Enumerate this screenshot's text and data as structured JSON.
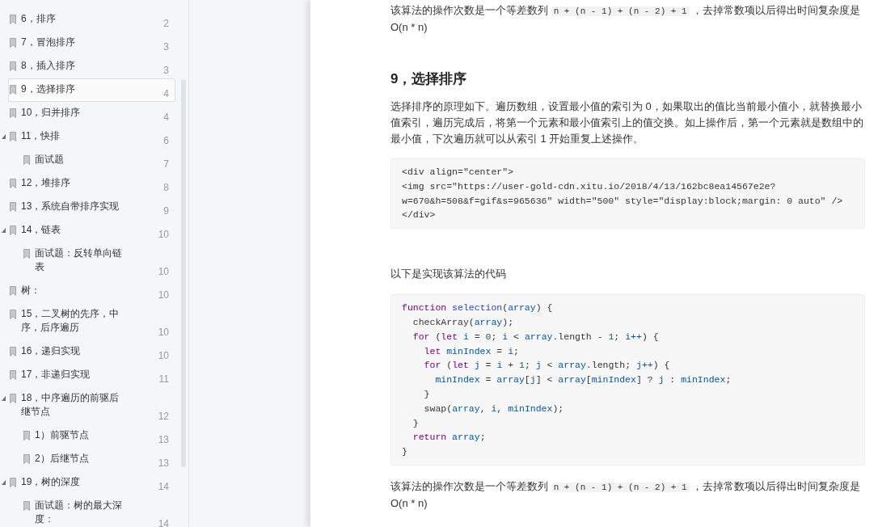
{
  "outline": {
    "items": [
      {
        "title": "6，排序",
        "page": "2",
        "selected": false
      },
      {
        "title": "7，冒泡排序",
        "page": "3",
        "selected": false
      },
      {
        "title": "8，插入排序",
        "page": "3",
        "selected": false
      },
      {
        "title": "9，选择排序",
        "page": "4",
        "selected": true
      },
      {
        "title": "10，归并排序",
        "page": "4",
        "selected": false
      },
      {
        "title": "11，快排",
        "page": "6",
        "selected": false,
        "expanded": true,
        "children": [
          {
            "title": "面试题",
            "page": "7",
            "selected": false
          }
        ]
      },
      {
        "title": "12，堆排序",
        "page": "8",
        "selected": false
      },
      {
        "title": "13，系统自带排序实现",
        "page": "9",
        "selected": false
      },
      {
        "title": "14，链表",
        "page": "10",
        "selected": false,
        "expanded": true,
        "children": [
          {
            "title": "面试题：反转单向链表",
            "page": "10",
            "selected": false
          }
        ]
      },
      {
        "title": "树：",
        "page": "10",
        "selected": false
      },
      {
        "title": "15，二叉树的先序，中序，后序遍历",
        "page": "10",
        "selected": false
      },
      {
        "title": "16，递归实现",
        "page": "10",
        "selected": false
      },
      {
        "title": "17，非递归实现",
        "page": "11",
        "selected": false
      },
      {
        "title": "18，中序遍历的前驱后继节点",
        "page": "12",
        "selected": false,
        "expanded": true,
        "children": [
          {
            "title": "1）前驱节点",
            "page": "13",
            "selected": false
          },
          {
            "title": "2）后继节点",
            "page": "13",
            "selected": false
          }
        ]
      },
      {
        "title": "19，树的深度",
        "page": "14",
        "selected": false,
        "expanded": true,
        "children": [
          {
            "title": "面试题：树的最大深度：",
            "page": "14",
            "selected": false
          }
        ]
      }
    ]
  },
  "article": {
    "blocks": [
      {
        "kind": "paragraph",
        "lines": [
          [
            {
              "kind": "text",
              "text": "该算法的操作次数是一个等差数列 "
            },
            {
              "kind": "code",
              "text": "n + (n - 1) + (n - 2) + 1"
            },
            {
              "kind": "text",
              "text": " ，去掉常数项以后得出时间复杂度是"
            }
          ],
          [
            {
              "kind": "text",
              "text": "O(n * n)"
            }
          ]
        ]
      },
      {
        "kind": "heading",
        "text": "9，选择排序"
      },
      {
        "kind": "paragraph",
        "lines": [
          [
            {
              "kind": "text",
              "text": "选择排序的原理如下。遍历数组，设置最小值的索引为 0，如果取出的值比当前最小值小，就替换最小"
            }
          ],
          [
            {
              "kind": "text",
              "text": "值索引，遍历完成后，将第一个元素和最小值索引上的值交换。如上操作后，第一个元素就是数组中的"
            }
          ],
          [
            {
              "kind": "text",
              "text": "最小值，下次遍历就可以从索引 1 开始重复上述操作。"
            }
          ]
        ]
      },
      {
        "kind": "code_block",
        "lines": [
          [
            {
              "kind": "plain",
              "text": "<div align=\"center\">"
            }
          ],
          [
            {
              "kind": "plain",
              "text": "<img src=\"https://user-gold-cdn.xitu.io/2018/4/13/162bc8ea14567e2e?"
            }
          ],
          [
            {
              "kind": "plain",
              "text": "w=670&h=508&f=gif&s=965636\" width=\"500\" style=\"display:block;margin: 0 auto\" />"
            }
          ],
          [
            {
              "kind": "plain",
              "text": "</div>"
            }
          ]
        ]
      },
      {
        "kind": "paragraph",
        "lines": [
          [
            {
              "kind": "text",
              "text": "以下是实现该算法的代码"
            }
          ]
        ]
      },
      {
        "kind": "code_block",
        "lines": [
          [
            {
              "kind": "keyword",
              "text": "function"
            },
            {
              "kind": "def",
              "text": " selection"
            },
            {
              "kind": "plain",
              "text": "("
            },
            {
              "kind": "variable",
              "text": "array"
            },
            {
              "kind": "plain",
              "text": ") {"
            }
          ],
          [
            {
              "kind": "plain",
              "text": "  checkArray("
            },
            {
              "kind": "variable",
              "text": "array"
            },
            {
              "kind": "plain",
              "text": ");"
            }
          ],
          [
            {
              "kind": "keyword",
              "text": "  for"
            },
            {
              "kind": "plain",
              "text": " ("
            },
            {
              "kind": "keyword",
              "text": "let"
            },
            {
              "kind": "variable",
              "text": " i"
            },
            {
              "kind": "plain",
              "text": " = "
            },
            {
              "kind": "number",
              "text": "0"
            },
            {
              "kind": "plain",
              "text": "; "
            },
            {
              "kind": "variable",
              "text": "i"
            },
            {
              "kind": "plain",
              "text": " < "
            },
            {
              "kind": "variable",
              "text": "array"
            },
            {
              "kind": "plain",
              "text": ".length - "
            },
            {
              "kind": "number",
              "text": "1"
            },
            {
              "kind": "plain",
              "text": "; "
            },
            {
              "kind": "variable",
              "text": "i++"
            },
            {
              "kind": "plain",
              "text": ") {"
            }
          ],
          [
            {
              "kind": "keyword",
              "text": "    let"
            },
            {
              "kind": "variable",
              "text": " minIndex"
            },
            {
              "kind": "plain",
              "text": " = "
            },
            {
              "kind": "variable",
              "text": "i"
            },
            {
              "kind": "plain",
              "text": ";"
            }
          ],
          [
            {
              "kind": "keyword",
              "text": "    for"
            },
            {
              "kind": "plain",
              "text": " ("
            },
            {
              "kind": "keyword",
              "text": "let"
            },
            {
              "kind": "variable",
              "text": " j"
            },
            {
              "kind": "plain",
              "text": " = "
            },
            {
              "kind": "variable",
              "text": "i"
            },
            {
              "kind": "plain",
              "text": " + "
            },
            {
              "kind": "number",
              "text": "1"
            },
            {
              "kind": "plain",
              "text": "; "
            },
            {
              "kind": "variable",
              "text": "j"
            },
            {
              "kind": "plain",
              "text": " < "
            },
            {
              "kind": "variable",
              "text": "array"
            },
            {
              "kind": "plain",
              "text": ".length; "
            },
            {
              "kind": "variable",
              "text": "j++"
            },
            {
              "kind": "plain",
              "text": ") {"
            }
          ],
          [
            {
              "kind": "variable",
              "text": "      minIndex"
            },
            {
              "kind": "plain",
              "text": " = "
            },
            {
              "kind": "variable",
              "text": "array"
            },
            {
              "kind": "plain",
              "text": "["
            },
            {
              "kind": "variable",
              "text": "j"
            },
            {
              "kind": "plain",
              "text": "] < "
            },
            {
              "kind": "variable",
              "text": "array"
            },
            {
              "kind": "plain",
              "text": "["
            },
            {
              "kind": "variable",
              "text": "minIndex"
            },
            {
              "kind": "plain",
              "text": "] ? "
            },
            {
              "kind": "variable",
              "text": "j"
            },
            {
              "kind": "plain",
              "text": " : "
            },
            {
              "kind": "variable",
              "text": "minIndex"
            },
            {
              "kind": "plain",
              "text": ";"
            }
          ],
          [
            {
              "kind": "plain",
              "text": "    }"
            }
          ],
          [
            {
              "kind": "plain",
              "text": "    swap("
            },
            {
              "kind": "variable",
              "text": "array"
            },
            {
              "kind": "plain",
              "text": ", "
            },
            {
              "kind": "variable",
              "text": "i"
            },
            {
              "kind": "plain",
              "text": ", "
            },
            {
              "kind": "variable",
              "text": "minIndex"
            },
            {
              "kind": "plain",
              "text": ");"
            }
          ],
          [
            {
              "kind": "plain",
              "text": "  }"
            }
          ],
          [
            {
              "kind": "keyword",
              "text": "  return"
            },
            {
              "kind": "variable",
              "text": " array"
            },
            {
              "kind": "plain",
              "text": ";"
            }
          ],
          [
            {
              "kind": "plain",
              "text": "}"
            }
          ]
        ]
      },
      {
        "kind": "paragraph",
        "lines": [
          [
            {
              "kind": "text",
              "text": "该算法的操作次数是一个等差数列 "
            },
            {
              "kind": "code",
              "text": "n + (n - 1) + (n - 2) + 1"
            },
            {
              "kind": "text",
              "text": " ，去掉常数项以后得出时间复杂度是"
            }
          ],
          [
            {
              "kind": "text",
              "text": "O(n * n)"
            }
          ]
        ]
      }
    ]
  }
}
